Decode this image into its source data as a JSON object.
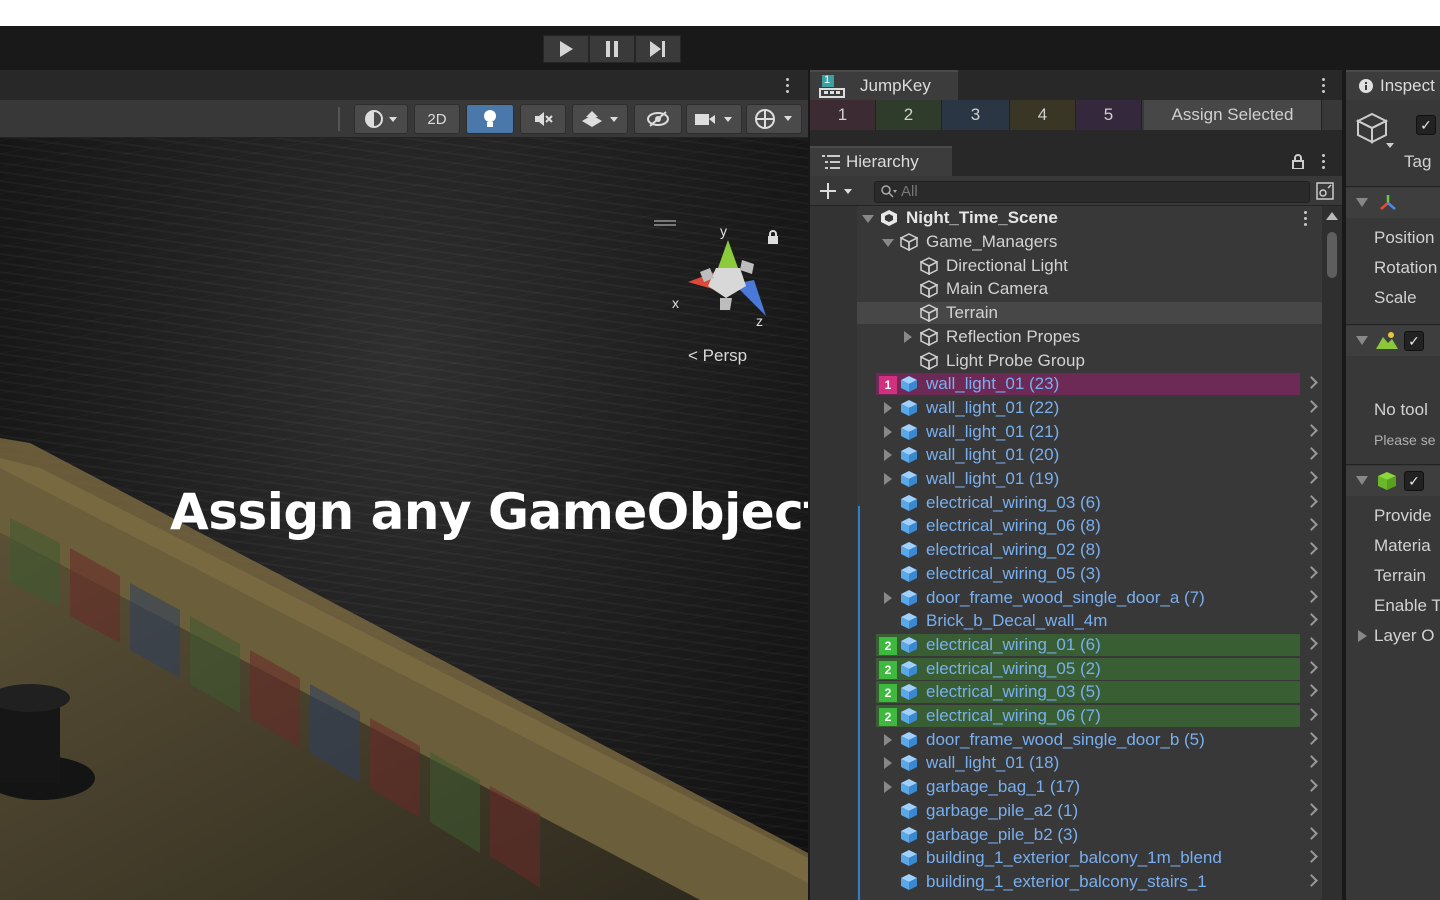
{
  "scene_view": {
    "headline": "Assign any GameObjects",
    "projection_label": "Persp",
    "mode_2d_label": "2D",
    "gizmo_axes": {
      "x": "x",
      "y": "y",
      "z": "z"
    }
  },
  "jumpkey": {
    "tab_title": "JumpKey",
    "tab_badge": "1",
    "buttons": [
      "1",
      "2",
      "3",
      "4",
      "5"
    ],
    "assign_label": "Assign Selected"
  },
  "hierarchy": {
    "tab_title": "Hierarchy",
    "search_placeholder": "All",
    "scene_name": "Night_Time_Scene",
    "items": [
      {
        "label": "Game_Managers"
      },
      {
        "label": "Directional Light"
      },
      {
        "label": "Main Camera"
      },
      {
        "label": "Terrain"
      },
      {
        "label": "Reflection Propes"
      },
      {
        "label": "Light Probe Group"
      },
      {
        "label": "wall_light_01 (23)",
        "badge": "1"
      },
      {
        "label": "wall_light_01 (22)"
      },
      {
        "label": "wall_light_01 (21)"
      },
      {
        "label": "wall_light_01 (20)"
      },
      {
        "label": "wall_light_01 (19)"
      },
      {
        "label": "electrical_wiring_03 (6)"
      },
      {
        "label": "electrical_wiring_06 (8)"
      },
      {
        "label": "electrical_wiring_02 (8)"
      },
      {
        "label": "electrical_wiring_05 (3)"
      },
      {
        "label": "door_frame_wood_single_door_a (7)"
      },
      {
        "label": "Brick_b_Decal_wall_4m"
      },
      {
        "label": "electrical_wiring_01 (6)",
        "badge": "2"
      },
      {
        "label": "electrical_wiring_05 (2)",
        "badge": "2"
      },
      {
        "label": "electrical_wiring_03 (5)",
        "badge": "2"
      },
      {
        "label": "electrical_wiring_06 (7)",
        "badge": "2"
      },
      {
        "label": "door_frame_wood_single_door_b (5)"
      },
      {
        "label": "wall_light_01 (18)"
      },
      {
        "label": "garbage_bag_1 (17)"
      },
      {
        "label": "garbage_pile_a2 (1)"
      },
      {
        "label": "garbage_pile_b2 (3)"
      },
      {
        "label": "building_1_exterior_balcony_1m_blend"
      },
      {
        "label": "building_1_exterior_balcony_stairs_1"
      }
    ]
  },
  "inspector": {
    "tab_title": "Inspect",
    "tag_label": "Tag",
    "transform": {
      "position": "Position",
      "rotation": "Rotation",
      "scale": "Scale"
    },
    "tool_message": "No tool",
    "tool_hint": "Please se",
    "terrain": {
      "provide": "Provide",
      "material": "Materia",
      "terrain": "Terrain",
      "enable": "Enable T",
      "layer": "Layer O"
    }
  },
  "colors": {
    "badge_1": "#d0307e",
    "row_1_bg": "#6e2a56",
    "badge_2": "#3fb83f",
    "row_2_bg": "#3a5e34",
    "prefab_text": "#78aff0",
    "active_tool": "#4a78aa"
  }
}
